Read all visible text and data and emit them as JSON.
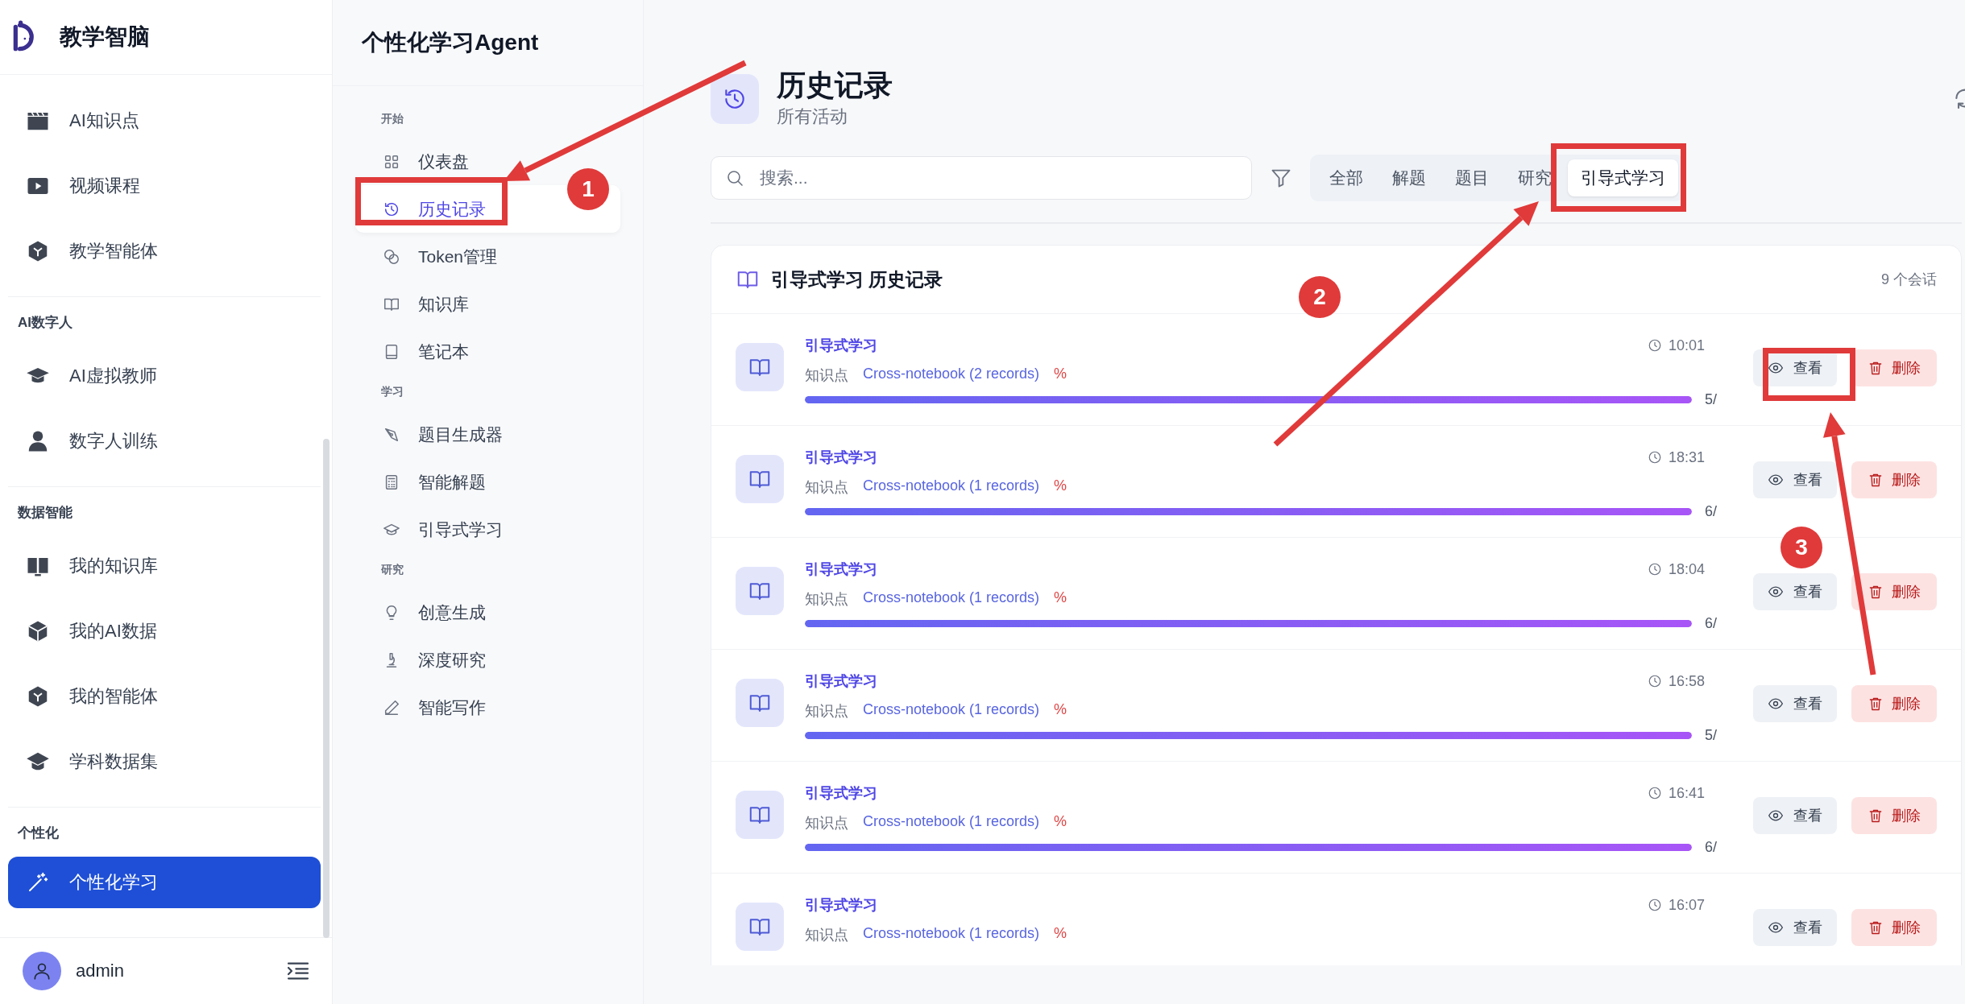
{
  "sidebar": {
    "brand": "教学智脑",
    "groups": [
      {
        "items": [
          {
            "label": "AI知识点",
            "selected": false
          },
          {
            "label": "视频课程",
            "selected": false
          },
          {
            "label": "教学智能体",
            "selected": false
          }
        ]
      },
      {
        "title": "AI数字人",
        "items": [
          {
            "label": "AI虚拟教师",
            "selected": false
          },
          {
            "label": "数字人训练",
            "selected": false
          }
        ]
      },
      {
        "title": "数据智能",
        "items": [
          {
            "label": "我的知识库",
            "selected": false
          },
          {
            "label": "我的AI数据",
            "selected": false
          },
          {
            "label": "我的智能体",
            "selected": false
          },
          {
            "label": "学科数据集",
            "selected": false
          }
        ]
      },
      {
        "title": "个性化",
        "items": [
          {
            "label": "个性化学习",
            "selected": true
          }
        ]
      }
    ],
    "user": {
      "name": "admin"
    }
  },
  "agent_nav": {
    "title": "个性化学习Agent",
    "sections": [
      {
        "title": "开始",
        "items": [
          {
            "label": "仪表盘",
            "selected": false
          },
          {
            "label": "历史记录",
            "selected": true
          },
          {
            "label": "Token管理",
            "selected": false
          },
          {
            "label": "知识库",
            "selected": false
          },
          {
            "label": "笔记本",
            "selected": false
          }
        ]
      },
      {
        "title": "学习",
        "items": [
          {
            "label": "题目生成器",
            "selected": false
          },
          {
            "label": "智能解题",
            "selected": false
          },
          {
            "label": "引导式学习",
            "selected": false
          }
        ]
      },
      {
        "title": "研究",
        "items": [
          {
            "label": "创意生成",
            "selected": false
          },
          {
            "label": "深度研究",
            "selected": false
          },
          {
            "label": "智能写作",
            "selected": false
          }
        ]
      }
    ]
  },
  "page": {
    "title": "历史记录",
    "subtitle": "所有活动"
  },
  "search": {
    "placeholder": "搜索..."
  },
  "filters": [
    {
      "label": "全部",
      "selected": false
    },
    {
      "label": "解题",
      "selected": false
    },
    {
      "label": "题目",
      "selected": false
    },
    {
      "label": "研究",
      "selected": false
    },
    {
      "label": "引导式学习",
      "selected": true
    }
  ],
  "history": {
    "title": "引导式学习 历史记录",
    "count": "9 个会话",
    "sessions": [
      {
        "title": "引导式学习",
        "time": "10:01",
        "label": "知识点",
        "source": "Cross-notebook (2 records)",
        "percent": "%",
        "level": 1,
        "progress_text": "5/",
        "view": "查看",
        "delete": "删除"
      },
      {
        "title": "引导式学习",
        "time": "18:31",
        "label": "知识点",
        "source": "Cross-notebook (1 records)",
        "percent": "%",
        "level": 1,
        "progress_text": "6/",
        "view": "查看",
        "delete": "删除"
      },
      {
        "title": "引导式学习",
        "time": "18:04",
        "label": "知识点",
        "source": "Cross-notebook (1 records)",
        "percent": "%",
        "level": 1,
        "progress_text": "6/",
        "view": "查看",
        "delete": "删除"
      },
      {
        "title": "引导式学习",
        "time": "16:58",
        "label": "知识点",
        "source": "Cross-notebook (1 records)",
        "percent": "%",
        "level": 1,
        "progress_text": "5/",
        "view": "查看",
        "delete": "删除"
      },
      {
        "title": "引导式学习",
        "time": "16:41",
        "label": "知识点",
        "source": "Cross-notebook (1 records)",
        "percent": "%",
        "level": 1,
        "progress_text": "6/",
        "view": "查看",
        "delete": "删除"
      },
      {
        "title": "引导式学习",
        "time": "16:07",
        "label": "知识点",
        "source": "Cross-notebook (1 records)",
        "percent": "%",
        "view": "查看",
        "delete": "删除"
      }
    ]
  },
  "annotations": [
    {
      "label": "1"
    },
    {
      "label": "2"
    },
    {
      "label": "3"
    }
  ]
}
